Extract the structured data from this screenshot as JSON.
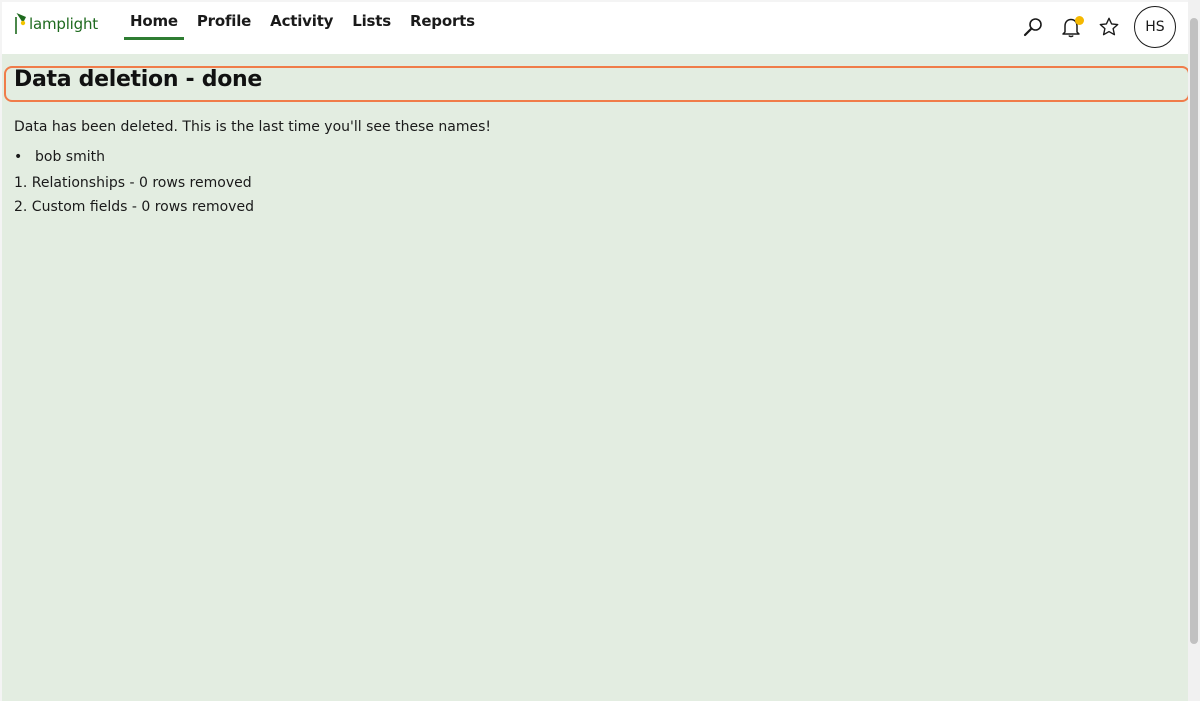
{
  "brand": {
    "name": "lamplight",
    "logo_icon": "lamp-icon",
    "brand_color": "#1e6a1e",
    "accent_color": "#f2c400"
  },
  "nav": {
    "items": [
      {
        "label": "Home",
        "active": true
      },
      {
        "label": "Profile",
        "active": false
      },
      {
        "label": "Activity",
        "active": false
      },
      {
        "label": "Lists",
        "active": false
      },
      {
        "label": "Reports",
        "active": false
      }
    ],
    "active_underline_color": "#2e7d32"
  },
  "header_icons": {
    "search": "search-icon",
    "notifications": "bell-icon",
    "notification_dot_color": "#f5b800",
    "favourites": "star-icon"
  },
  "user": {
    "initials": "HS"
  },
  "page": {
    "background_color": "#e3ede1",
    "title": "Data deletion - done",
    "title_highlight_color": "#f07c4a",
    "message": "Data has been deleted. This is the last time you'll see these names!",
    "deleted_names": [
      "bob smith"
    ],
    "results": [
      "1. Relationships - 0 rows removed",
      "2. Custom fields - 0 rows removed"
    ]
  }
}
